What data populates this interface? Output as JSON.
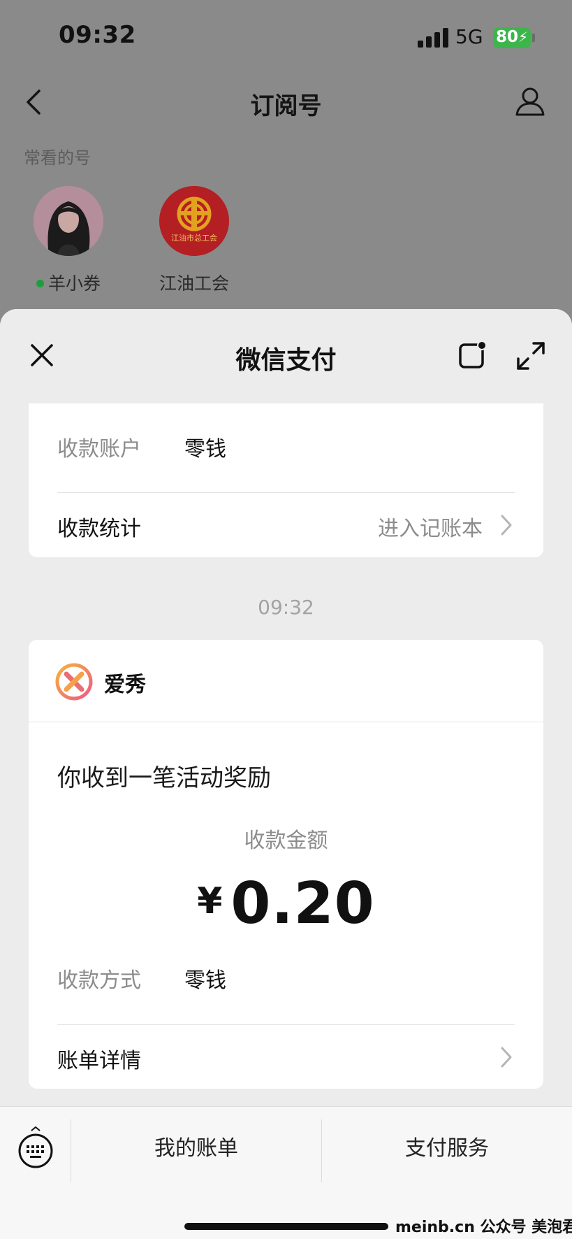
{
  "status_bar": {
    "time": "09:32",
    "network": "5G",
    "battery": "80"
  },
  "nav": {
    "title": "订阅号"
  },
  "frequent": {
    "label": "常看的号",
    "accounts": [
      {
        "name": "羊小券",
        "online": true
      },
      {
        "name": "江油工会",
        "online": false,
        "logo_text": "江油市总工会"
      }
    ]
  },
  "sheet": {
    "title": "微信支付"
  },
  "top_card": {
    "account_label": "收款账户",
    "account_value": "零钱",
    "stats_label": "收款统计",
    "stats_link": "进入记账本"
  },
  "message_time": "09:32",
  "payment_card": {
    "merchant": "爱秀",
    "notice": "你收到一笔活动奖励",
    "amount_label": "收款金额",
    "currency": "¥",
    "amount": "0.20",
    "method_label": "收款方式",
    "method_value": "零钱",
    "details_label": "账单详情"
  },
  "bottom_menu": {
    "items": [
      "我的账单",
      "支付服务"
    ]
  },
  "watermark": "meinb.cn 公众号 美泡君",
  "colors": {
    "accent_green": "#1f9d3d",
    "battery_green": "#3cb54a",
    "dim_overlay": "#8a8a8a"
  },
  "icons": [
    "back-icon",
    "profile-icon",
    "close-icon",
    "floating-window-icon",
    "expand-icon",
    "chevron-right-icon",
    "keyboard-icon"
  ]
}
